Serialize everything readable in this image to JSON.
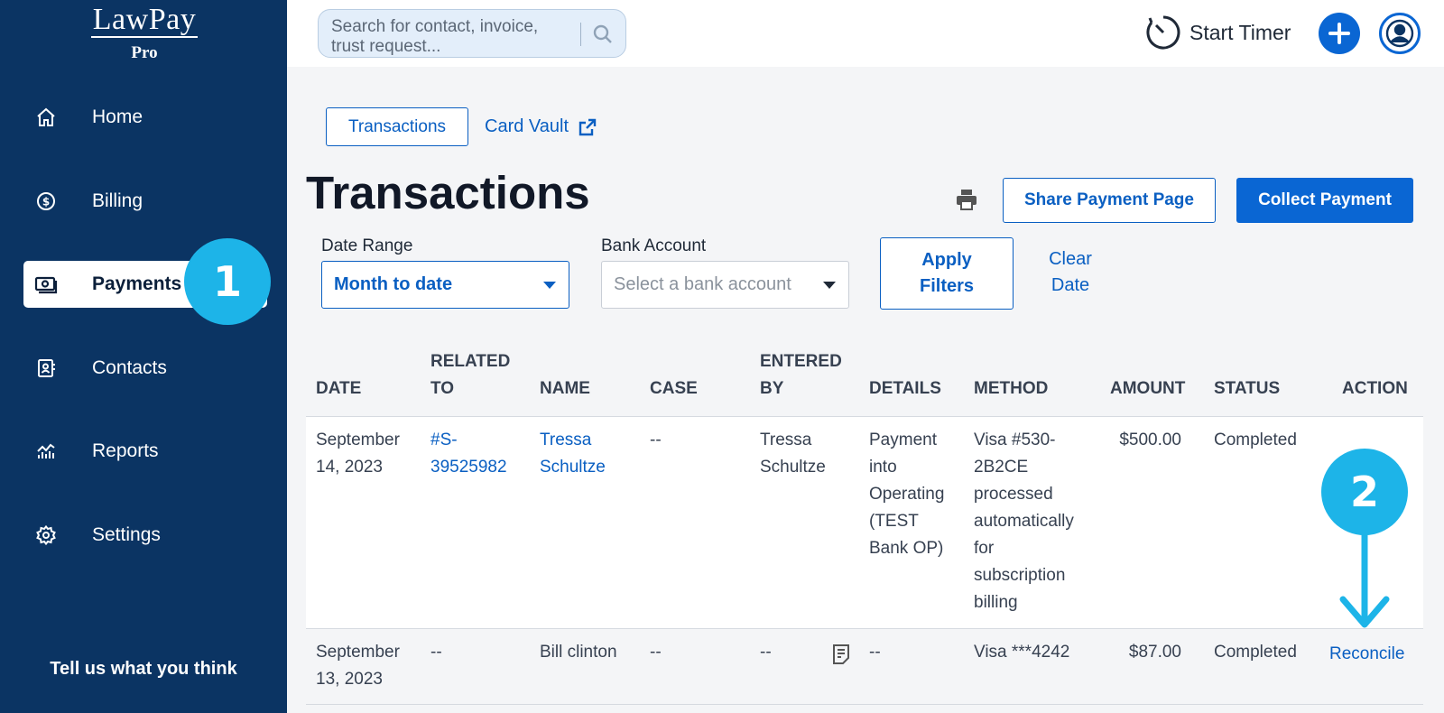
{
  "brand": {
    "name": "LawPay",
    "tier": "Pro"
  },
  "sidebar": {
    "items": [
      {
        "label": "Home",
        "icon": "home-icon"
      },
      {
        "label": "Billing",
        "icon": "dollar-circle-icon"
      },
      {
        "label": "Payments",
        "icon": "cash-icon",
        "active": true
      },
      {
        "label": "Contacts",
        "icon": "contact-card-icon"
      },
      {
        "label": "Reports",
        "icon": "chart-icon"
      },
      {
        "label": "Settings",
        "icon": "gear-icon"
      }
    ],
    "feedback": "Tell us what you think"
  },
  "callouts": {
    "first": "1",
    "second": "2"
  },
  "topbar": {
    "search_placeholder": "Search for contact, invoice, trust request...",
    "timer_label": "Start Timer"
  },
  "tabs": {
    "transactions": "Transactions",
    "card_vault": "Card Vault"
  },
  "page": {
    "title": "Transactions",
    "share_button": "Share Payment Page",
    "collect_button": "Collect Payment"
  },
  "filters": {
    "date_range_label": "Date Range",
    "date_range_value": "Month to date",
    "bank_account_label": "Bank Account",
    "bank_account_placeholder": "Select a bank account",
    "apply_line1": "Apply",
    "apply_line2": "Filters",
    "clear_line1": "Clear",
    "clear_line2": "Date"
  },
  "table": {
    "headers": {
      "date": "DATE",
      "related_to_1": "RELATED",
      "related_to_2": "TO",
      "name": "NAME",
      "case": "CASE",
      "entered_by_1": "ENTERED",
      "entered_by_2": "BY",
      "details": "DETAILS",
      "method": "METHOD",
      "amount": "AMOUNT",
      "status": "STATUS",
      "action": "ACTION"
    },
    "rows": [
      {
        "date_1": "September",
        "date_2": "14, 2023",
        "related_1": "#S-",
        "related_2": "39525982",
        "name_1": "Tressa",
        "name_2": "Schultze",
        "case": "--",
        "entered_by_1": "Tressa",
        "entered_by_2": "Schultze",
        "details": [
          "Payment",
          "into",
          "Operating",
          "(TEST",
          "Bank OP)"
        ],
        "method": [
          "Visa #530-",
          "2B2CE",
          "processed",
          "automatically",
          "for",
          "subscription",
          "billing"
        ],
        "amount": "$500.00",
        "status": "Completed"
      },
      {
        "date_1": "September",
        "date_2": "13, 2023",
        "related": "--",
        "name": "Bill clinton",
        "case": "--",
        "entered_by": "--",
        "details": "--",
        "method": "Visa ***4242",
        "amount": "$87.00",
        "status": "Completed",
        "action": "Reconcile"
      }
    ]
  },
  "colors": {
    "sidebar_bg": "#0b3463",
    "primary": "#0a66d3",
    "link": "#0a5fc2",
    "callout": "#1db4e8"
  }
}
